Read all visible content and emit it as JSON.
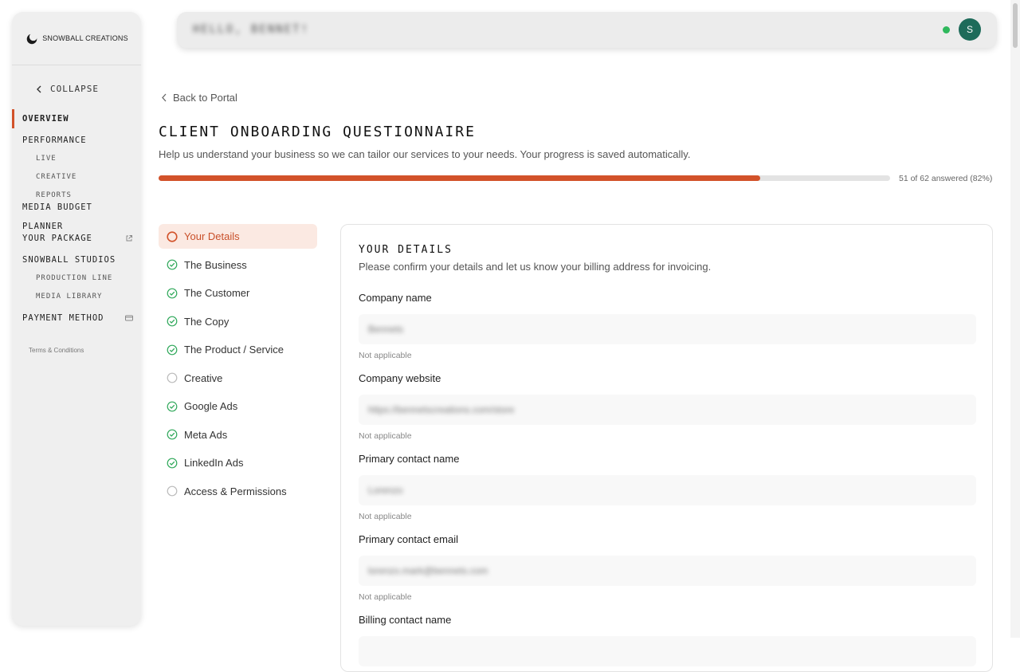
{
  "sidebar": {
    "logo_text": "SNOWBALL CREATIONS",
    "collapse_label": "COLLAPSE",
    "items": [
      {
        "label": "OVERVIEW"
      },
      {
        "label": "PERFORMANCE"
      },
      {
        "label": "LIVE"
      },
      {
        "label": "CREATIVE"
      },
      {
        "label": "REPORTS"
      },
      {
        "label": "MEDIA BUDGET PLANNER"
      },
      {
        "label": "YOUR PACKAGE"
      },
      {
        "label": "SNOWBALL STUDIOS"
      },
      {
        "label": "PRODUCTION LINE"
      },
      {
        "label": "MEDIA LIBRARY"
      },
      {
        "label": "PAYMENT METHOD"
      }
    ],
    "terms_label": "Terms & Conditions"
  },
  "topbar": {
    "greeting": "HELLO, BENNET!",
    "avatar_initial": "S",
    "status_color": "#2fb85c",
    "avatar_color": "#1e6b5a"
  },
  "main": {
    "back_label": "Back to Portal",
    "title": "CLIENT ONBOARDING QUESTIONNAIRE",
    "subtitle": "Help us understand your business so we can tailor our services to your needs. Your progress is saved automatically.",
    "progress": {
      "answered": 51,
      "total": 62,
      "percent": 82,
      "text": "51 of 62 answered (82%)",
      "accent_color": "#d2522a"
    },
    "sections": [
      {
        "label": "Your Details",
        "status": "active"
      },
      {
        "label": "The Business",
        "status": "complete"
      },
      {
        "label": "The Customer",
        "status": "complete"
      },
      {
        "label": "The Copy",
        "status": "complete"
      },
      {
        "label": "The Product / Service",
        "status": "complete"
      },
      {
        "label": "Creative",
        "status": "incomplete"
      },
      {
        "label": "Google Ads",
        "status": "complete"
      },
      {
        "label": "Meta Ads",
        "status": "complete"
      },
      {
        "label": "LinkedIn Ads",
        "status": "complete"
      },
      {
        "label": "Access & Permissions",
        "status": "incomplete"
      }
    ],
    "card": {
      "title": "YOUR DETAILS",
      "description": "Please confirm your details and let us know your billing address for invoicing.",
      "fields": [
        {
          "label": "Company name",
          "value": "Bennets",
          "hint": "Not applicable"
        },
        {
          "label": "Company website",
          "value": "https://bennetscreations.com/store",
          "hint": "Not applicable"
        },
        {
          "label": "Primary contact name",
          "value": "Lorenzo",
          "hint": "Not applicable"
        },
        {
          "label": "Primary contact email",
          "value": "lorenzo.mark@bennets.com",
          "hint": "Not applicable"
        },
        {
          "label": "Billing contact name",
          "value": "",
          "hint": ""
        }
      ]
    }
  }
}
